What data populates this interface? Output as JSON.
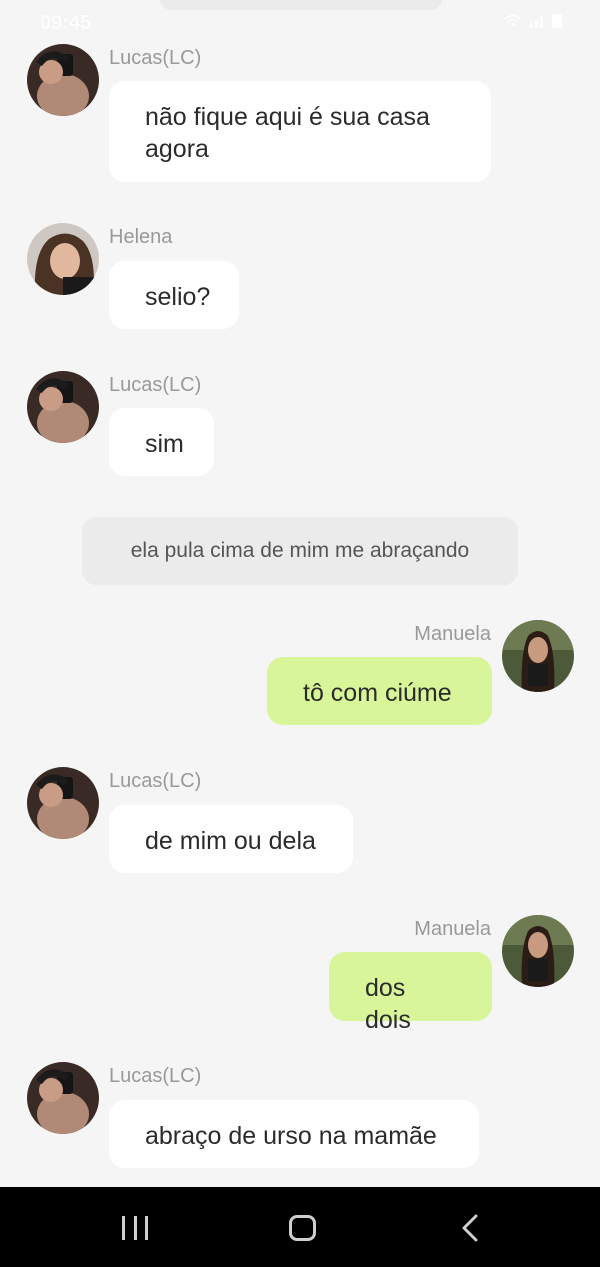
{
  "status_bar": {
    "time": "09:45"
  },
  "messages": [
    {
      "sender": "Lucas(LC)",
      "text": "não fique aqui é sua casa agora"
    },
    {
      "sender": "Helena",
      "text": "selio?"
    },
    {
      "sender": "Lucas(LC)",
      "text": "sim"
    },
    {
      "narration": "ela pula cima de mim me abraçando"
    },
    {
      "sender": "Manuela",
      "text": "tô com ciúme"
    },
    {
      "sender": "Lucas(LC)",
      "text": "de mim ou dela"
    },
    {
      "sender": "Manuela",
      "text": "dos dois"
    },
    {
      "sender": "Lucas(LC)",
      "text": "abraço de urso na mamãe"
    }
  ],
  "colors": {
    "background": "#f5f5f5",
    "incoming_bubble": "#ffffff",
    "outgoing_bubble": "#d8f59a",
    "narration_bubble": "#ebebeb",
    "name_text": "#999999",
    "nav_bar": "#000000"
  },
  "icons": {
    "nav_recents": "recents-icon",
    "nav_home": "home-icon",
    "nav_back": "back-icon"
  }
}
